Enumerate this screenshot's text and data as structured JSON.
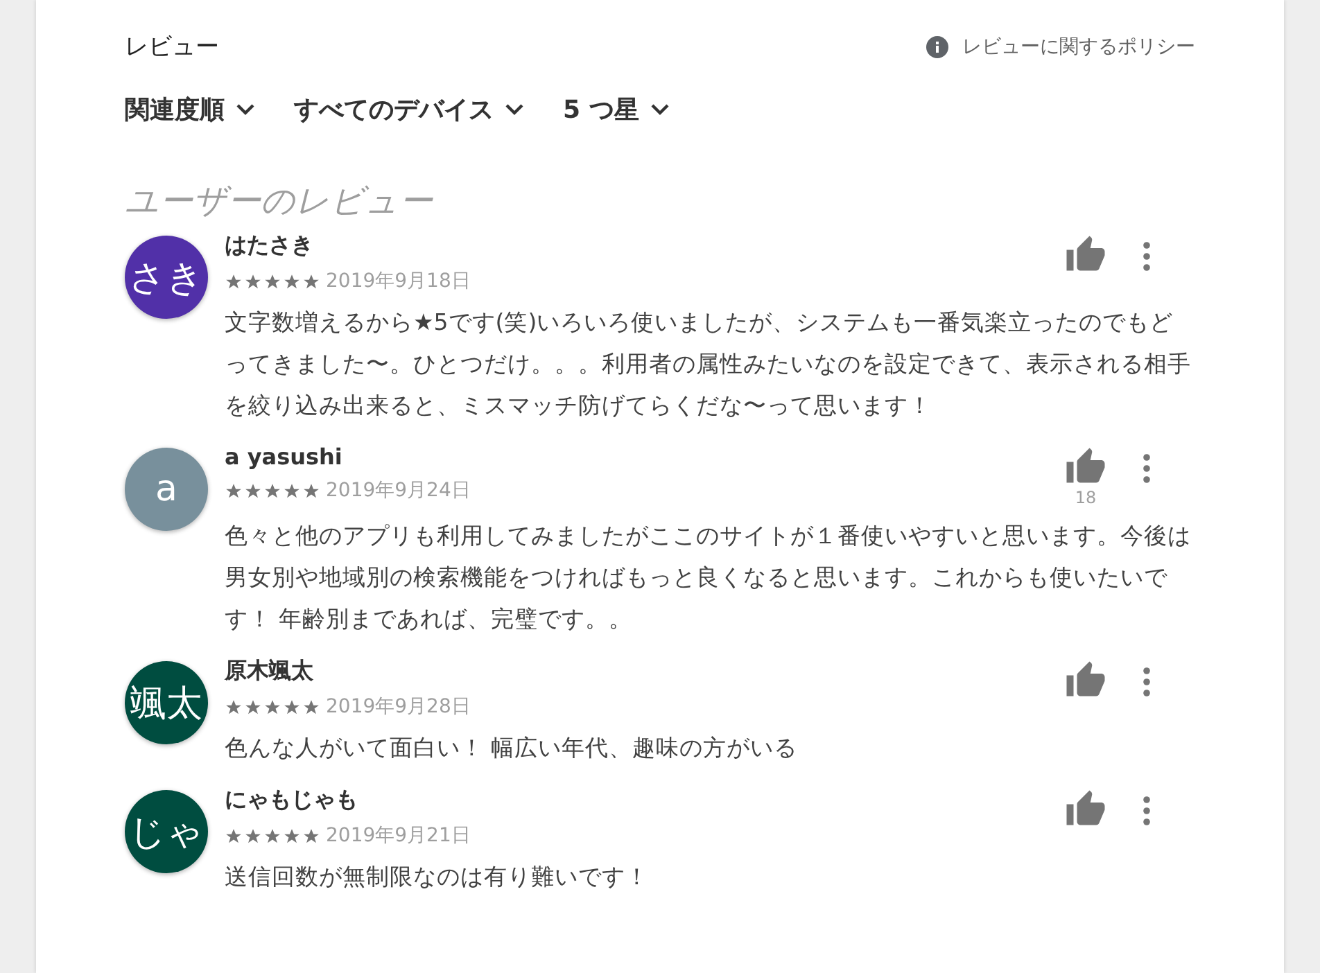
{
  "header": {
    "title": "レビュー",
    "policy_link": "レビューに関するポリシー"
  },
  "filters": [
    {
      "label": "関連度順"
    },
    {
      "label": "すべてのデバイス"
    },
    {
      "label": "5 つ星"
    }
  ],
  "section_title": "ユーザーのレビュー",
  "reviews": [
    {
      "avatar_text": "さき",
      "color": "#5130a8",
      "name": "はたさき",
      "stars": 5,
      "date": "2019年9月18日",
      "text": "文字数増えるから★5です(笑)いろいろ使いましたが、システムも一番気楽立ったのでもどってきました〜。ひとつだけ。。。利用者の属性みたいなのを設定できて、表示される相手を絞り込み出来ると、ミスマッチ防げてらくだな〜って思います！"
    },
    {
      "avatar_text": "a",
      "color": "#78909c",
      "name": "a yasushi",
      "stars": 5,
      "date": "2019年9月24日",
      "likes": "18",
      "text": "色々と他のアプリも利用してみましたがここのサイトが１番使いやすいと思います。今後は男女別や地域別の検索機能をつければもっと良くなると思います。これからも使いたいです！ 年齢別まであれば、完璧です。。"
    },
    {
      "avatar_text": "颯太",
      "color": "#004d40",
      "name": "原木颯太",
      "stars": 5,
      "date": "2019年9月28日",
      "text": "色んな人がいて面白い！ 幅広い年代、趣味の方がいる"
    },
    {
      "avatar_text": "じゃ",
      "color": "#004d40",
      "name": "にゃもじゃも",
      "stars": 5,
      "date": "2019年9月21日",
      "text": "送信回数が無制限なのは有り難いです！"
    }
  ]
}
